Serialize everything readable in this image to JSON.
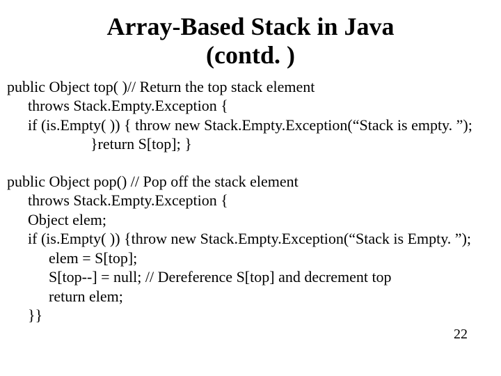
{
  "title_line1": "Array-Based Stack in Java",
  "title_line2": "(contd. )",
  "top_fn": {
    "sig": "public Object top( )// Return the top stack element",
    "throws": "throws Stack.Empty.Exception {",
    "if_part": "if (is.Empty( )) { throw new Stack.Empty.Exception(“Stack is empty. ”);",
    "ret": "}return S[top]; }"
  },
  "pop_fn": {
    "sig": "public Object pop() // Pop off the stack element",
    "throws": "throws Stack.Empty.Exception {",
    "decl": "Object elem;",
    "if_part": "if (is.Empty( )) {throw new Stack.Empty.Exception(“Stack is Empty. ”);",
    "assign": "elem = S[top];",
    "nullify": "S[top--] = null; // Dereference S[top] and decrement top",
    "ret": "return elem;",
    "close": "}}"
  },
  "page_number": "22"
}
